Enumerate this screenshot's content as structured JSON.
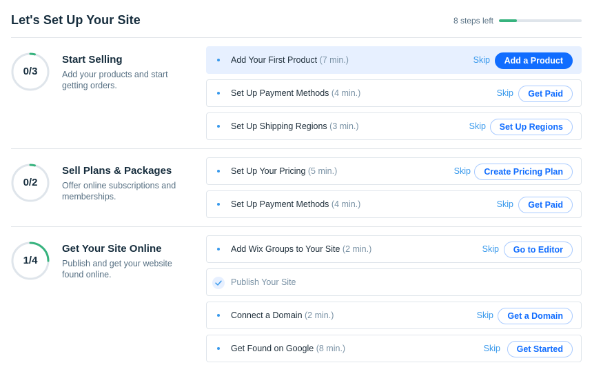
{
  "header": {
    "title": "Let's Set Up Your Site",
    "steps_left": "8 steps left",
    "progress_fraction": 0.22
  },
  "colors": {
    "accent_blue": "#116dff",
    "progress_green": "#37b37e",
    "highlight_bg": "#e7f0ff"
  },
  "sections": [
    {
      "progress": "0/3",
      "title": "Start Selling",
      "description": "Add your products and start getting orders.",
      "ring_fraction": 0.04,
      "tasks": [
        {
          "label": "Add Your First Product",
          "duration": "(7 min.)",
          "skip": "Skip",
          "action": "Add a Product"
        },
        {
          "label": "Set Up Payment Methods",
          "duration": "(4 min.)",
          "skip": "Skip",
          "action": "Get Paid"
        },
        {
          "label": "Set Up Shipping Regions",
          "duration": "(3 min.)",
          "skip": "Skip",
          "action": "Set Up Regions"
        }
      ]
    },
    {
      "progress": "0/2",
      "title": "Sell Plans & Packages",
      "description": "Offer online subscriptions and memberships.",
      "ring_fraction": 0.04,
      "tasks": [
        {
          "label": "Set Up Your Pricing",
          "duration": "(5 min.)",
          "skip": "Skip",
          "action": "Create Pricing Plan"
        },
        {
          "label": "Set Up Payment Methods",
          "duration": "(4 min.)",
          "skip": "Skip",
          "action": "Get Paid"
        }
      ]
    },
    {
      "progress": "1/4",
      "title": "Get Your Site Online",
      "description": "Publish and get your website found online.",
      "ring_fraction": 0.25,
      "tasks": [
        {
          "label": "Add Wix Groups to Your Site",
          "duration": "(2 min.)",
          "skip": "Skip",
          "action": "Go to Editor"
        },
        {
          "label": "Publish Your Site"
        },
        {
          "label": "Connect a Domain",
          "duration": "(2 min.)",
          "skip": "Skip",
          "action": "Get a Domain"
        },
        {
          "label": "Get Found on Google",
          "duration": "(8 min.)",
          "skip": "Skip",
          "action": "Get Started"
        }
      ]
    }
  ]
}
